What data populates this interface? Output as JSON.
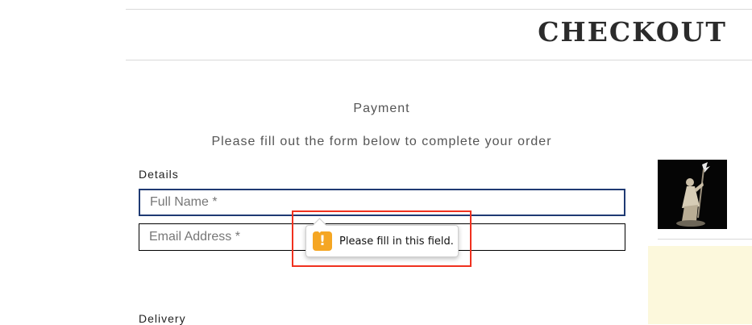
{
  "header": {
    "title": "CHECKOUT"
  },
  "payment": {
    "heading": "Payment",
    "subheading": "Please fill out the form below to complete your order"
  },
  "details": {
    "label": "Details",
    "full_name_placeholder": "Full Name *",
    "email_placeholder": "Email Address *"
  },
  "validation": {
    "message": "Please fill in this field.",
    "icon": "warning-icon",
    "icon_color": "#f5a623",
    "highlight_color": "#f0311f"
  },
  "delivery": {
    "label": "Delivery"
  },
  "sidebar": {
    "product_image": "wizard-miniature-figure"
  },
  "colors": {
    "focus_border": "#1f3a73",
    "summary_background": "#fcf8dc"
  }
}
